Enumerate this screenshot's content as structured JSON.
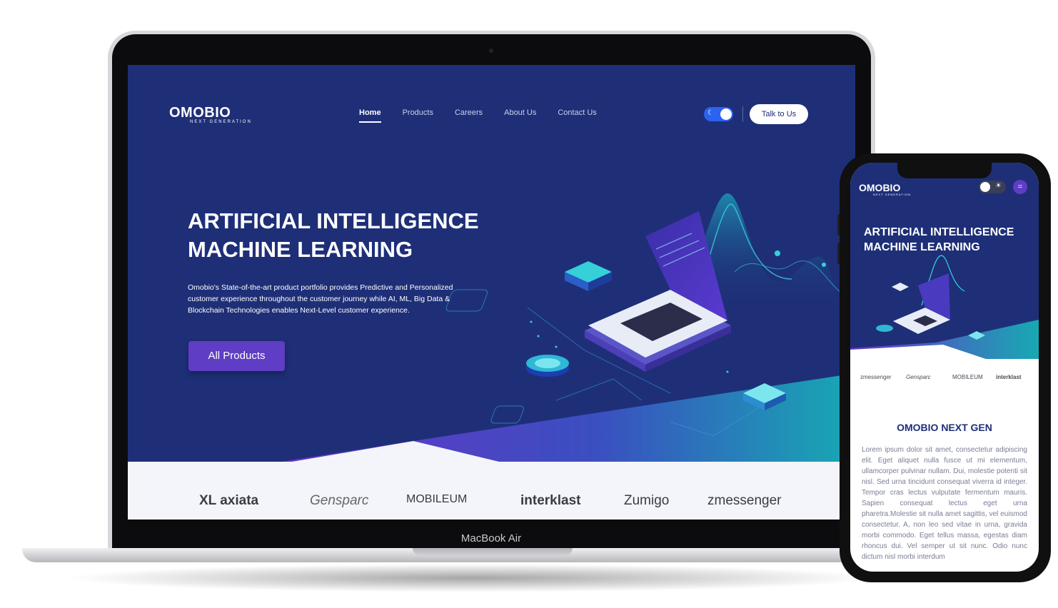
{
  "device": {
    "laptop_label": "MacBook Air"
  },
  "site": {
    "logo": "OMOBIO",
    "logo_sub": "NEXT GENERATION",
    "nav": [
      {
        "label": "Home",
        "active": true
      },
      {
        "label": "Products",
        "active": false
      },
      {
        "label": "Careers",
        "active": false
      },
      {
        "label": "About Us",
        "active": false
      },
      {
        "label": "Contact Us",
        "active": false
      }
    ],
    "theme_toggle_icon": "moon-icon",
    "cta_talk": "Talk to Us",
    "hero": {
      "title_line1": "ARTIFICIAL INTELLIGENCE",
      "title_line2": "MACHINE LEARNING",
      "description": "Omobio's State-of-the-art product portfolio provides Predictive and Personalized customer experience throughout the customer journey while AI, ML, Big Data & Blockchain Technologies enables Next-Level customer experience.",
      "button": "All Products"
    },
    "partner_logos": [
      "XL axiata",
      "Gensparc",
      "MOBILEUM",
      "interklast",
      "Zumigo",
      "zmessenger"
    ],
    "colors": {
      "brand_dark": "#1e2f78",
      "accent_purple": "#5f3dc4",
      "accent_teal": "#1aa3b0",
      "toggle_blue": "#2c62f0"
    }
  },
  "mobile": {
    "logo": "OMOBIO",
    "logo_sub": "NEXT GENERATION",
    "theme_toggle_icon": "sun-icon",
    "menu_icon": "menu-icon",
    "hero_title_line1": "ARTIFICIAL INTELLIGENCE",
    "hero_title_line2": "MACHINE LEARNING",
    "partner_logos": [
      "zmessenger",
      "Gensparc",
      "MOBILEUM",
      "interklast"
    ],
    "section_title": "OMOBIO NEXT GEN",
    "section_body": "Lorem ipsum dolor sit amet, consectetur adipiscing elit. Eget aliquet nulla fusce ut mi elementum, ullamcorper pulvinar nullam. Dui, molestie potenti sit nisl. Sed urna tincidunt consequat viverra id integer. Tempor cras lectus vulputate fermentum mauris. Sapien consequat lectus eget urna pharetra.Molestie sit nulla amet sagittis, vel euismod consectetur. A, non leo sed vitae in urna, gravida morbi commodo. Eget tellus massa, egestas diam rhoncus dui. Vel semper ut sit nunc. Odio nunc dictum nisl morbi interdum"
  }
}
